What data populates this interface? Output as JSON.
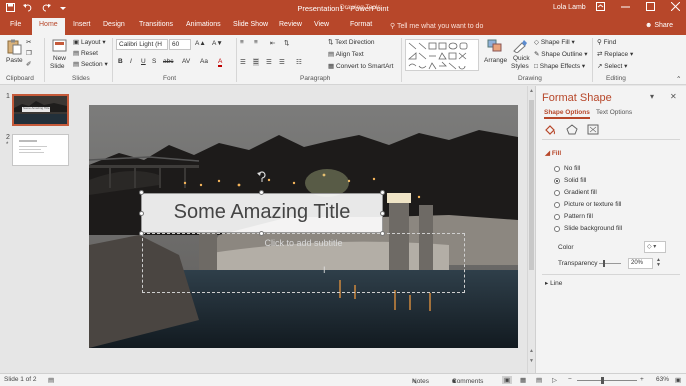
{
  "titlebar": {
    "qat": [
      "save-icon",
      "undo-icon",
      "redo-icon",
      "customize-icon"
    ],
    "doc_title": "Presentation1 - PowerPoint",
    "context_group": "Drawing Tools",
    "user": "Lola Lamb",
    "window_controls": [
      "ribbon-display-icon",
      "minimize-icon",
      "maximize-icon",
      "close-icon"
    ]
  },
  "tabs": {
    "items": [
      "File",
      "Home",
      "Insert",
      "Design",
      "Transitions",
      "Animations",
      "Slide Show",
      "Review",
      "View",
      "Format"
    ],
    "active": "Home",
    "tell_me": "Tell me what you want to do",
    "share": "Share"
  },
  "ribbon": {
    "clipboard": {
      "paste": "Paste",
      "label": "Clipboard"
    },
    "slides": {
      "new_slide_1": "New",
      "new_slide_2": "Slide",
      "layout": "Layout",
      "reset": "Reset",
      "section": "Section",
      "label": "Slides"
    },
    "font": {
      "name": "Calibri Light (H",
      "size": "60",
      "label": "Font",
      "bold": "B",
      "italic": "I",
      "underline": "U",
      "strike": "S",
      "shadow": "abc",
      "spacing": "AV",
      "case": "Aa",
      "color": "A"
    },
    "paragraph": {
      "text_direction": "Text Direction",
      "align_text": "Align Text",
      "convert_smartart": "Convert to SmartArt",
      "label": "Paragraph"
    },
    "drawing": {
      "arrange": "Arrange",
      "quick_styles_1": "Quick",
      "quick_styles_2": "Styles",
      "shape_fill": "Shape Fill",
      "shape_outline": "Shape Outline",
      "shape_effects": "Shape Effects",
      "label": "Drawing"
    },
    "editing": {
      "find": "Find",
      "replace": "Replace",
      "select": "Select",
      "label": "Editing"
    }
  },
  "slides_panel": {
    "slides": [
      {
        "number": "1",
        "thumb_title": "Some Amazing Title"
      },
      {
        "number": "2",
        "marker": "*"
      }
    ]
  },
  "slide": {
    "title": "Some Amazing Title",
    "subtitle_placeholder": "Click to add subtitle"
  },
  "format_pane": {
    "title": "Format Shape",
    "tabs": [
      "Shape Options",
      "Text Options"
    ],
    "active_tab": "Shape Options",
    "icons": [
      "fill-line-icon",
      "effects-icon",
      "size-properties-icon"
    ],
    "fill_section": "Fill",
    "fill_options": [
      {
        "label": "No fill",
        "selected": false
      },
      {
        "label": "Solid fill",
        "selected": true
      },
      {
        "label": "Gradient fill",
        "selected": false
      },
      {
        "label": "Picture or texture fill",
        "selected": false
      },
      {
        "label": "Pattern fill",
        "selected": false
      },
      {
        "label": "Slide background fill",
        "selected": false
      }
    ],
    "color_label": "Color",
    "transparency_label": "Transparency",
    "transparency_value": "20%",
    "transparency_level": 0.2,
    "line_section": "Line"
  },
  "status": {
    "slide_info": "Slide 1 of 2",
    "notes": "Notes",
    "comments": "Comments",
    "zoom": "63%"
  },
  "colors": {
    "accent": "#b7472a",
    "ribbon_bg": "#f3f3f3",
    "workspace_bg": "#e6e6e6"
  }
}
